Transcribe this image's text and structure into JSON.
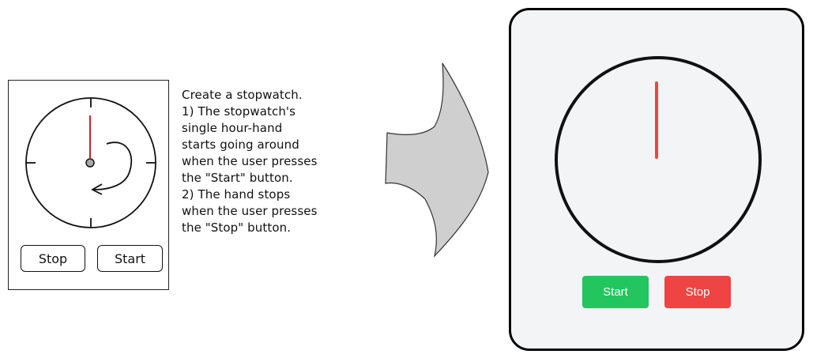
{
  "sketch": {
    "buttons": {
      "stop_label": "Stop",
      "start_label": "Start"
    },
    "colors": {
      "hand": "#cc2222",
      "stroke": "#111111",
      "pivot": "#aaaaaa"
    }
  },
  "instructions": {
    "lines": [
      "Create a stopwatch.",
      "1) The stopwatch's",
      "single hour-hand",
      "starts going around",
      "when the user presses",
      "the \"Start\" button.",
      "2) The hand stops",
      "when the user presses",
      "the \"Stop\" button."
    ]
  },
  "arrow": {
    "fill": "#cfcfcf",
    "stroke": "#333333"
  },
  "device": {
    "buttons": {
      "start_label": "Start",
      "stop_label": "Stop"
    },
    "colors": {
      "background": "#f3f4f6",
      "hand": "#ef4444",
      "start": "#22c55e",
      "stop": "#ef4444"
    }
  }
}
